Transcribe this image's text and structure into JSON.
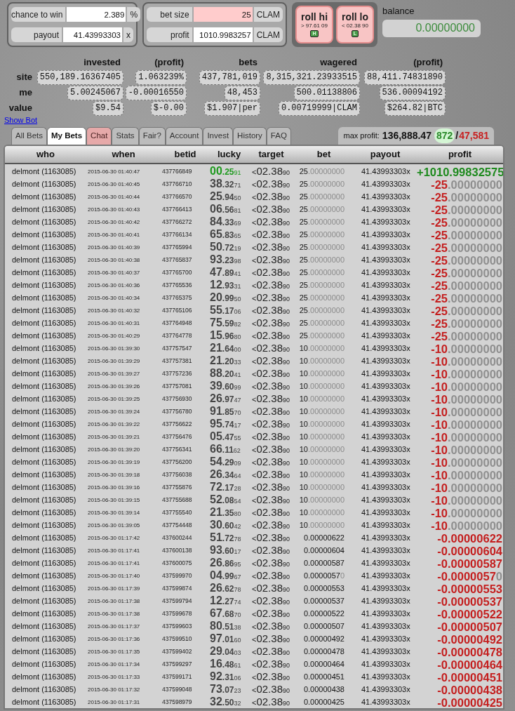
{
  "bet_form": {
    "fields": [
      {
        "label": "chance to win",
        "value": "2.389",
        "unit": "%",
        "highlighted": false
      },
      {
        "label": "payout",
        "value": "41.43993303",
        "unit": "x",
        "highlighted": false
      }
    ]
  },
  "amount_form": {
    "fields": [
      {
        "label": "bet size",
        "value": "25",
        "unit": "CLAM",
        "highlighted": true
      },
      {
        "label": "profit",
        "value": "1010.9983257",
        "unit": "CLAM",
        "highlighted": false
      }
    ]
  },
  "roll_buttons": [
    {
      "label": "roll hi",
      "target": "> 97.61 09",
      "key": "H"
    },
    {
      "label": "roll lo",
      "target": "< 02.38 90",
      "key": "L"
    }
  ],
  "balance": {
    "label": "balance",
    "value": "0.00000000"
  },
  "stats": {
    "columns": [
      "invested",
      "(profit)",
      "bets",
      "wagered",
      "(profit)"
    ],
    "rows": [
      {
        "label": "site",
        "cells": [
          "550,189.16367405",
          "1.063239%",
          "437,781,019",
          "8,315,321.23933515",
          "88,411.74831890"
        ]
      },
      {
        "label": "me",
        "cells": [
          "5.00245067",
          "-0.00016550",
          "48,453",
          "500.01138806",
          "536.00094192"
        ]
      },
      {
        "label": "value",
        "cells": [
          "$9.54",
          "$-0.00",
          "$1.907|per",
          "0.00719999|CLAM",
          "$264.82|BTC"
        ]
      }
    ]
  },
  "show_bot": "Show Bot",
  "tabs": [
    {
      "label": "All Bets",
      "selected": false,
      "highlighted": false
    },
    {
      "label": "My Bets",
      "selected": true,
      "highlighted": false
    },
    {
      "label": "Chat",
      "selected": false,
      "highlighted": true
    },
    {
      "label": "Stats",
      "selected": false,
      "highlighted": false
    },
    {
      "label": "Fair?",
      "selected": false,
      "highlighted": false
    },
    {
      "label": "Account",
      "selected": false,
      "highlighted": false
    },
    {
      "label": "Invest",
      "selected": false,
      "highlighted": false
    },
    {
      "label": "History",
      "selected": false,
      "highlighted": false
    },
    {
      "label": "FAQ",
      "selected": false,
      "highlighted": false
    }
  ],
  "max_profit": {
    "label": "max profit:",
    "value": "136,888.47",
    "wins": "872",
    "separator": "/",
    "losses": "47,581"
  },
  "table": {
    "columns": [
      "who",
      "when",
      "betid",
      "lucky",
      "target",
      "bet",
      "payout",
      "profit"
    ],
    "rows": [
      {
        "who": "delmont (1163085)",
        "when": "2015-06-30 01:40:47",
        "betid": "437766849",
        "lucky": "00.2591",
        "target": "<02.3890",
        "bet": "25.00000000",
        "payout": "41.43993303x",
        "profit": "+1010.99832575",
        "win": true
      },
      {
        "who": "delmont (1163085)",
        "when": "2015-06-30 01:40:45",
        "betid": "437766710",
        "lucky": "38.3271",
        "target": "<02.3890",
        "bet": "25.00000000",
        "payout": "41.43993303x",
        "profit": "-25.00000000",
        "win": false
      },
      {
        "who": "delmont (1163085)",
        "when": "2015-06-30 01:40:44",
        "betid": "437766570",
        "lucky": "25.9450",
        "target": "<02.3890",
        "bet": "25.00000000",
        "payout": "41.43993303x",
        "profit": "-25.00000000",
        "win": false
      },
      {
        "who": "delmont (1163085)",
        "when": "2015-06-30 01:40:43",
        "betid": "437766413",
        "lucky": "06.5681",
        "target": "<02.3890",
        "bet": "25.00000000",
        "payout": "41.43993303x",
        "profit": "-25.00000000",
        "win": false
      },
      {
        "who": "delmont (1163085)",
        "when": "2015-06-30 01:40:42",
        "betid": "437766272",
        "lucky": "84.3369",
        "target": "<02.3890",
        "bet": "25.00000000",
        "payout": "41.43993303x",
        "profit": "-25.00000000",
        "win": false
      },
      {
        "who": "delmont (1163085)",
        "when": "2015-06-30 01:40:41",
        "betid": "437766134",
        "lucky": "65.8365",
        "target": "<02.3890",
        "bet": "25.00000000",
        "payout": "41.43993303x",
        "profit": "-25.00000000",
        "win": false
      },
      {
        "who": "delmont (1163085)",
        "when": "2015-06-30 01:40:39",
        "betid": "437765994",
        "lucky": "50.7219",
        "target": "<02.3890",
        "bet": "25.00000000",
        "payout": "41.43993303x",
        "profit": "-25.00000000",
        "win": false
      },
      {
        "who": "delmont (1163085)",
        "when": "2015-06-30 01:40:38",
        "betid": "437765837",
        "lucky": "93.2398",
        "target": "<02.3890",
        "bet": "25.00000000",
        "payout": "41.43993303x",
        "profit": "-25.00000000",
        "win": false
      },
      {
        "who": "delmont (1163085)",
        "when": "2015-06-30 01:40:37",
        "betid": "437765700",
        "lucky": "47.8941",
        "target": "<02.3890",
        "bet": "25.00000000",
        "payout": "41.43993303x",
        "profit": "-25.00000000",
        "win": false
      },
      {
        "who": "delmont (1163085)",
        "when": "2015-06-30 01:40:36",
        "betid": "437765536",
        "lucky": "12.9331",
        "target": "<02.3890",
        "bet": "25.00000000",
        "payout": "41.43993303x",
        "profit": "-25.00000000",
        "win": false
      },
      {
        "who": "delmont (1163085)",
        "when": "2015-06-30 01:40:34",
        "betid": "437765375",
        "lucky": "20.9950",
        "target": "<02.3890",
        "bet": "25.00000000",
        "payout": "41.43993303x",
        "profit": "-25.00000000",
        "win": false
      },
      {
        "who": "delmont (1163085)",
        "when": "2015-06-30 01:40:32",
        "betid": "437765106",
        "lucky": "55.1706",
        "target": "<02.3890",
        "bet": "25.00000000",
        "payout": "41.43993303x",
        "profit": "-25.00000000",
        "win": false
      },
      {
        "who": "delmont (1163085)",
        "when": "2015-06-30 01:40:31",
        "betid": "437764948",
        "lucky": "75.5982",
        "target": "<02.3890",
        "bet": "25.00000000",
        "payout": "41.43993303x",
        "profit": "-25.00000000",
        "win": false
      },
      {
        "who": "delmont (1163085)",
        "when": "2015-06-30 01:40:29",
        "betid": "437764778",
        "lucky": "15.9680",
        "target": "<02.3890",
        "bet": "25.00000000",
        "payout": "41.43993303x",
        "profit": "-25.00000000",
        "win": false
      },
      {
        "who": "delmont (1163085)",
        "when": "2015-06-30 01:39:30",
        "betid": "437757547",
        "lucky": "21.6400",
        "target": "<02.3890",
        "bet": "10.00000000",
        "payout": "41.43993303x",
        "profit": "-10.00000000",
        "win": false
      },
      {
        "who": "delmont (1163085)",
        "when": "2015-06-30 01:39:29",
        "betid": "437757381",
        "lucky": "21.2033",
        "target": "<02.3890",
        "bet": "10.00000000",
        "payout": "41.43993303x",
        "profit": "-10.00000000",
        "win": false
      },
      {
        "who": "delmont (1163085)",
        "when": "2015-06-30 01:39:27",
        "betid": "437757236",
        "lucky": "88.2041",
        "target": "<02.3890",
        "bet": "10.00000000",
        "payout": "41.43993303x",
        "profit": "-10.00000000",
        "win": false
      },
      {
        "who": "delmont (1163085)",
        "when": "2015-06-30 01:39:26",
        "betid": "437757081",
        "lucky": "39.6099",
        "target": "<02.3890",
        "bet": "10.00000000",
        "payout": "41.43993303x",
        "profit": "-10.00000000",
        "win": false
      },
      {
        "who": "delmont (1163085)",
        "when": "2015-06-30 01:39:25",
        "betid": "437756930",
        "lucky": "26.9747",
        "target": "<02.3890",
        "bet": "10.00000000",
        "payout": "41.43993303x",
        "profit": "-10.00000000",
        "win": false
      },
      {
        "who": "delmont (1163085)",
        "when": "2015-06-30 01:39:24",
        "betid": "437756780",
        "lucky": "91.8570",
        "target": "<02.3890",
        "bet": "10.00000000",
        "payout": "41.43993303x",
        "profit": "-10.00000000",
        "win": false
      },
      {
        "who": "delmont (1163085)",
        "when": "2015-06-30 01:39:22",
        "betid": "437756622",
        "lucky": "95.7417",
        "target": "<02.3890",
        "bet": "10.00000000",
        "payout": "41.43993303x",
        "profit": "-10.00000000",
        "win": false
      },
      {
        "who": "delmont (1163085)",
        "when": "2015-06-30 01:39:21",
        "betid": "437756476",
        "lucky": "05.4755",
        "target": "<02.3890",
        "bet": "10.00000000",
        "payout": "41.43993303x",
        "profit": "-10.00000000",
        "win": false
      },
      {
        "who": "delmont (1163085)",
        "when": "2015-06-30 01:39:20",
        "betid": "437756341",
        "lucky": "66.1162",
        "target": "<02.3890",
        "bet": "10.00000000",
        "payout": "41.43993303x",
        "profit": "-10.00000000",
        "win": false
      },
      {
        "who": "delmont (1163085)",
        "when": "2015-06-30 01:39:19",
        "betid": "437756200",
        "lucky": "54.2909",
        "target": "<02.3890",
        "bet": "10.00000000",
        "payout": "41.43993303x",
        "profit": "-10.00000000",
        "win": false
      },
      {
        "who": "delmont (1163085)",
        "when": "2015-06-30 01:39:18",
        "betid": "437756038",
        "lucky": "26.3464",
        "target": "<02.3890",
        "bet": "10.00000000",
        "payout": "41.43993303x",
        "profit": "-10.00000000",
        "win": false
      },
      {
        "who": "delmont (1163085)",
        "when": "2015-06-30 01:39:16",
        "betid": "437755876",
        "lucky": "72.1728",
        "target": "<02.3890",
        "bet": "10.00000000",
        "payout": "41.43993303x",
        "profit": "-10.00000000",
        "win": false
      },
      {
        "who": "delmont (1163085)",
        "when": "2015-06-30 01:39:15",
        "betid": "437755688",
        "lucky": "52.0854",
        "target": "<02.3890",
        "bet": "10.00000000",
        "payout": "41.43993303x",
        "profit": "-10.00000000",
        "win": false
      },
      {
        "who": "delmont (1163085)",
        "when": "2015-06-30 01:39:14",
        "betid": "437755540",
        "lucky": "21.3580",
        "target": "<02.3890",
        "bet": "10.00000000",
        "payout": "41.43993303x",
        "profit": "-10.00000000",
        "win": false
      },
      {
        "who": "delmont (1163085)",
        "when": "2015-06-30 01:39:05",
        "betid": "437754448",
        "lucky": "30.6042",
        "target": "<02.3890",
        "bet": "10.00000000",
        "payout": "41.43993303x",
        "profit": "-10.00000000",
        "win": false
      },
      {
        "who": "delmont (1163085)",
        "when": "2015-06-30 01:17:42",
        "betid": "437600244",
        "lucky": "51.7278",
        "target": "<02.3890",
        "bet": "0.00000622",
        "payout": "41.43993303x",
        "profit": "-0.00000622",
        "win": false
      },
      {
        "who": "delmont (1163085)",
        "when": "2015-06-30 01:17:41",
        "betid": "437600138",
        "lucky": "93.6017",
        "target": "<02.3890",
        "bet": "0.00000604",
        "payout": "41.43993303x",
        "profit": "-0.00000604",
        "win": false
      },
      {
        "who": "delmont (1163085)",
        "when": "2015-06-30 01:17:41",
        "betid": "437600075",
        "lucky": "26.8695",
        "target": "<02.3890",
        "bet": "0.00000587",
        "payout": "41.43993303x",
        "profit": "-0.00000587",
        "win": false
      },
      {
        "who": "delmont (1163085)",
        "when": "2015-06-30 01:17:40",
        "betid": "437599970",
        "lucky": "04.9967",
        "target": "<02.3890",
        "bet": "0.00000570",
        "payout": "41.43993303x",
        "profit": "-0.00000570",
        "win": false
      },
      {
        "who": "delmont (1163085)",
        "when": "2015-06-30 01:17:39",
        "betid": "437599874",
        "lucky": "26.6278",
        "target": "<02.3890",
        "bet": "0.00000553",
        "payout": "41.43993303x",
        "profit": "-0.00000553",
        "win": false
      },
      {
        "who": "delmont (1163085)",
        "when": "2015-06-30 01:17:38",
        "betid": "437599794",
        "lucky": "12.2774",
        "target": "<02.3890",
        "bet": "0.00000537",
        "payout": "41.43993303x",
        "profit": "-0.00000537",
        "win": false
      },
      {
        "who": "delmont (1163085)",
        "when": "2015-06-30 01:17:38",
        "betid": "437599678",
        "lucky": "67.6870",
        "target": "<02.3890",
        "bet": "0.00000522",
        "payout": "41.43993303x",
        "profit": "-0.00000522",
        "win": false
      },
      {
        "who": "delmont (1163085)",
        "when": "2015-06-30 01:17:37",
        "betid": "437599603",
        "lucky": "80.5138",
        "target": "<02.3890",
        "bet": "0.00000507",
        "payout": "41.43993303x",
        "profit": "-0.00000507",
        "win": false
      },
      {
        "who": "delmont (1163085)",
        "when": "2015-06-30 01:17:36",
        "betid": "437599510",
        "lucky": "97.0160",
        "target": "<02.3890",
        "bet": "0.00000492",
        "payout": "41.43993303x",
        "profit": "-0.00000492",
        "win": false
      },
      {
        "who": "delmont (1163085)",
        "when": "2015-06-30 01:17:35",
        "betid": "437599402",
        "lucky": "29.0403",
        "target": "<02.3890",
        "bet": "0.00000478",
        "payout": "41.43993303x",
        "profit": "-0.00000478",
        "win": false
      },
      {
        "who": "delmont (1163085)",
        "when": "2015-06-30 01:17:34",
        "betid": "437599297",
        "lucky": "16.4861",
        "target": "<02.3890",
        "bet": "0.00000464",
        "payout": "41.43993303x",
        "profit": "-0.00000464",
        "win": false
      },
      {
        "who": "delmont (1163085)",
        "when": "2015-06-30 01:17:33",
        "betid": "437599171",
        "lucky": "92.3106",
        "target": "<02.3890",
        "bet": "0.00000451",
        "payout": "41.43993303x",
        "profit": "-0.00000451",
        "win": false
      },
      {
        "who": "delmont (1163085)",
        "when": "2015-06-30 01:17:32",
        "betid": "437599048",
        "lucky": "73.0723",
        "target": "<02.3890",
        "bet": "0.00000438",
        "payout": "41.43993303x",
        "profit": "-0.00000438",
        "win": false
      },
      {
        "who": "delmont (1163085)",
        "when": "2015-06-30 01:17:31",
        "betid": "437598979",
        "lucky": "32.5032",
        "target": "<02.3890",
        "bet": "0.00000425",
        "payout": "41.43993303x",
        "profit": "-0.00000425",
        "win": false
      }
    ]
  }
}
